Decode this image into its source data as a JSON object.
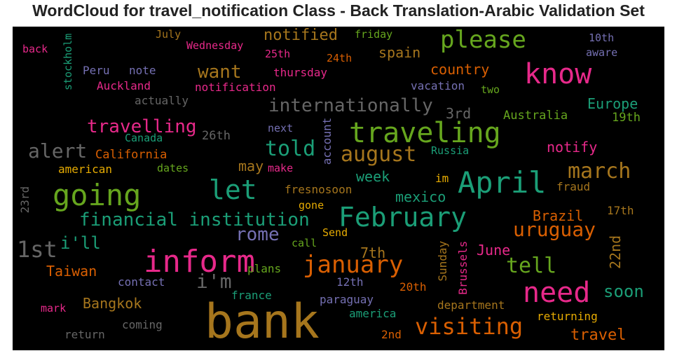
{
  "title": "WordCloud for travel_notification Class - Back Translation-Arabic Validation Set",
  "chart_data": {
    "type": "wordcloud",
    "background": "#000000",
    "words": [
      {
        "text": "bank",
        "color": "#a6761d"
      },
      {
        "text": "inform",
        "color": "#e7298a"
      },
      {
        "text": "going",
        "color": "#66a61e"
      },
      {
        "text": "April",
        "color": "#1b9e77"
      },
      {
        "text": "traveling",
        "color": "#66a61e"
      },
      {
        "text": "know",
        "color": "#e7298a"
      },
      {
        "text": "need",
        "color": "#e7298a"
      },
      {
        "text": "February",
        "color": "#1b9e77"
      },
      {
        "text": "let",
        "color": "#1b9e77"
      },
      {
        "text": "january",
        "color": "#d95f02"
      },
      {
        "text": "visiting",
        "color": "#d95f02"
      },
      {
        "text": "please",
        "color": "#66a61e"
      },
      {
        "text": "1st",
        "color": "#666666"
      },
      {
        "text": "internationally",
        "color": "#666666"
      },
      {
        "text": "financial institution",
        "color": "#1b9e77"
      },
      {
        "text": "march",
        "color": "#a6761d"
      },
      {
        "text": "uruguay",
        "color": "#d95f02"
      },
      {
        "text": "tell",
        "color": "#66a61e"
      },
      {
        "text": "august",
        "color": "#a6761d"
      },
      {
        "text": "told",
        "color": "#1b9e77"
      },
      {
        "text": "alert",
        "color": "#666666"
      },
      {
        "text": "i'm",
        "color": "#666666"
      },
      {
        "text": "travelling",
        "color": "#e7298a"
      },
      {
        "text": "want",
        "color": "#a6761d"
      },
      {
        "text": "rome",
        "color": "#7570b3"
      },
      {
        "text": "i'll",
        "color": "#1b9e77"
      },
      {
        "text": "soon",
        "color": "#1b9e77"
      },
      {
        "text": "travel",
        "color": "#d95f02"
      },
      {
        "text": "country",
        "color": "#d95f02"
      },
      {
        "text": "spain",
        "color": "#a6761d"
      },
      {
        "text": "notified",
        "color": "#a6761d"
      },
      {
        "text": "Europe",
        "color": "#1b9e77"
      },
      {
        "text": "notify",
        "color": "#e7298a"
      },
      {
        "text": "Brazil",
        "color": "#d95f02"
      },
      {
        "text": "mexico",
        "color": "#1b9e77"
      },
      {
        "text": "week",
        "color": "#1b9e77"
      },
      {
        "text": "Taiwan",
        "color": "#d95f02"
      },
      {
        "text": "Bangkok",
        "color": "#a6761d"
      },
      {
        "text": "June",
        "color": "#e7298a"
      },
      {
        "text": "22nd",
        "color": "#a6761d"
      },
      {
        "text": "7th",
        "color": "#a6761d"
      },
      {
        "text": "3rd",
        "color": "#666666"
      },
      {
        "text": "may",
        "color": "#a6761d"
      },
      {
        "text": "Australia",
        "color": "#66a61e"
      },
      {
        "text": "19th",
        "color": "#66a61e"
      },
      {
        "text": "26th",
        "color": "#666666"
      },
      {
        "text": "California",
        "color": "#d95f02"
      },
      {
        "text": "Canada",
        "color": "#1b9e77"
      },
      {
        "text": "american",
        "color": "#e6ab02"
      },
      {
        "text": "dates",
        "color": "#66a61e"
      },
      {
        "text": "make",
        "color": "#e7298a"
      },
      {
        "text": "next",
        "color": "#7570b3"
      },
      {
        "text": "account",
        "color": "#7570b3"
      },
      {
        "text": "Russia",
        "color": "#1b9e77"
      },
      {
        "text": "fresnosoon",
        "color": "#a6761d"
      },
      {
        "text": "im",
        "color": "#e6ab02"
      },
      {
        "text": "fraud",
        "color": "#a6761d"
      },
      {
        "text": "gone",
        "color": "#e6ab02"
      },
      {
        "text": "17th",
        "color": "#a6761d"
      },
      {
        "text": "Send",
        "color": "#e6ab02"
      },
      {
        "text": "call",
        "color": "#66a61e"
      },
      {
        "text": "plans",
        "color": "#66a61e"
      },
      {
        "text": "contact",
        "color": "#7570b3"
      },
      {
        "text": "12th",
        "color": "#7570b3"
      },
      {
        "text": "20th",
        "color": "#d95f02"
      },
      {
        "text": "france",
        "color": "#1b9e77"
      },
      {
        "text": "paraguay",
        "color": "#7570b3"
      },
      {
        "text": "department",
        "color": "#a6761d"
      },
      {
        "text": "america",
        "color": "#1b9e77"
      },
      {
        "text": "returning",
        "color": "#e6ab02"
      },
      {
        "text": "mark",
        "color": "#e7298a"
      },
      {
        "text": "coming",
        "color": "#666666"
      },
      {
        "text": "return",
        "color": "#666666"
      },
      {
        "text": "2nd",
        "color": "#d95f02"
      },
      {
        "text": "Sunday",
        "color": "#a6761d"
      },
      {
        "text": "Brussels",
        "color": "#e7298a"
      },
      {
        "text": "23rd",
        "color": "#666666"
      },
      {
        "text": "back",
        "color": "#e7298a"
      },
      {
        "text": "July",
        "color": "#a6761d"
      },
      {
        "text": "Wednesday",
        "color": "#e7298a"
      },
      {
        "text": "25th",
        "color": "#e7298a"
      },
      {
        "text": "friday",
        "color": "#66a61e"
      },
      {
        "text": "24th",
        "color": "#d95f02"
      },
      {
        "text": "10th",
        "color": "#7570b3"
      },
      {
        "text": "aware",
        "color": "#7570b3"
      },
      {
        "text": "stockholm",
        "color": "#1b9e77"
      },
      {
        "text": "Peru",
        "color": "#7570b3"
      },
      {
        "text": "note",
        "color": "#7570b3"
      },
      {
        "text": "thursday",
        "color": "#e7298a"
      },
      {
        "text": "Auckland",
        "color": "#e7298a"
      },
      {
        "text": "notification",
        "color": "#e7298a"
      },
      {
        "text": "vacation",
        "color": "#7570b3"
      },
      {
        "text": "two",
        "color": "#66a61e"
      },
      {
        "text": "actually",
        "color": "#666666"
      }
    ]
  }
}
